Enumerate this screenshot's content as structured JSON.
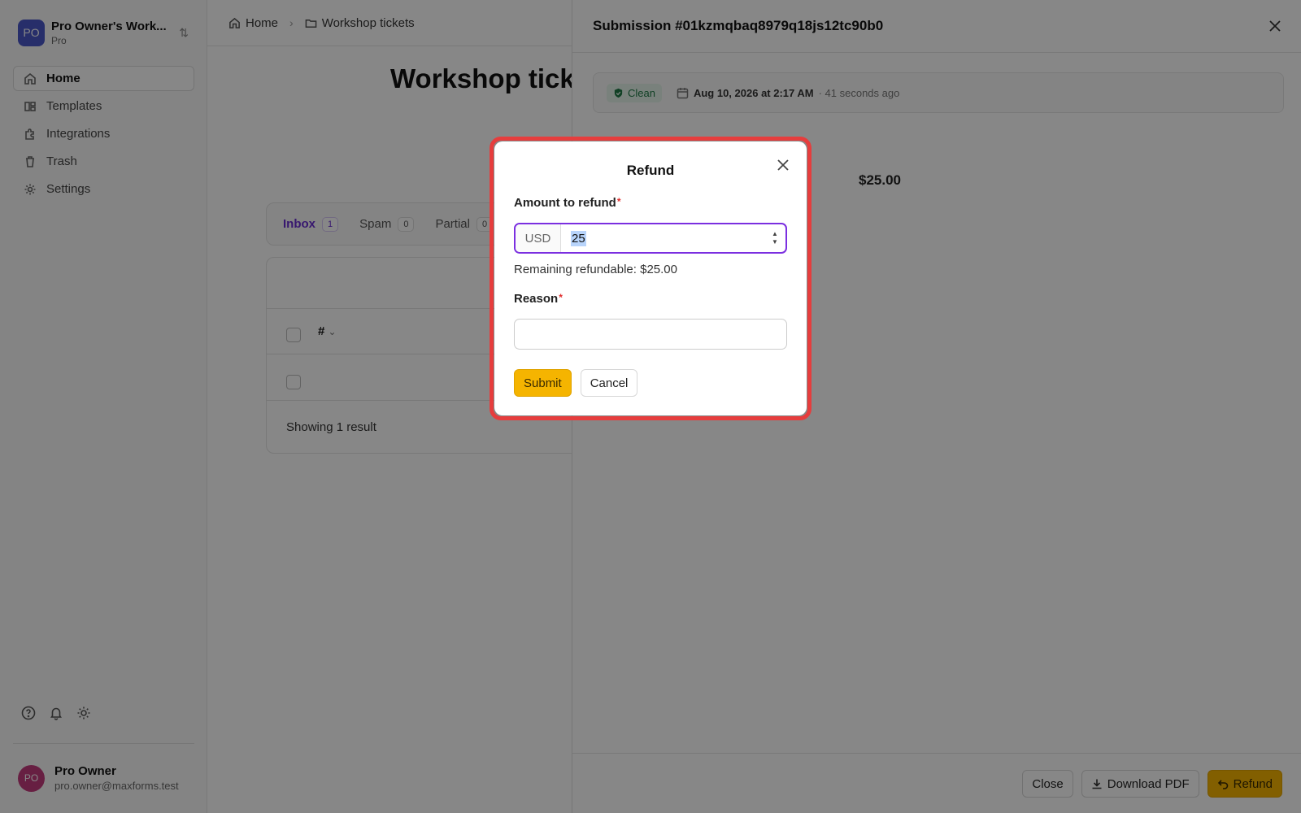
{
  "workspace": {
    "initials": "PO",
    "name": "Pro Owner's Work...",
    "plan": "Pro"
  },
  "nav": [
    {
      "label": "Home",
      "icon": "home-icon",
      "active": true
    },
    {
      "label": "Templates",
      "icon": "templates-icon"
    },
    {
      "label": "Integrations",
      "icon": "puzzle-icon"
    },
    {
      "label": "Trash",
      "icon": "trash-icon"
    },
    {
      "label": "Settings",
      "icon": "gear-icon"
    }
  ],
  "user": {
    "initials": "PO",
    "name": "Pro Owner",
    "email": "pro.owner@maxforms.test"
  },
  "breadcrumb": {
    "home": "Home",
    "current": "Workshop tickets"
  },
  "page": {
    "title": "Workshop tickets"
  },
  "tabs": [
    {
      "label": "Inbox",
      "count": "1"
    },
    {
      "label": "Spam",
      "count": "0"
    },
    {
      "label": "Partial",
      "count": "0"
    }
  ],
  "table": {
    "sort_column": "#",
    "footer": "Showing 1 result"
  },
  "panel": {
    "title": "Submission #01kzmqbaq8979q18js12tc90b0",
    "status": "Clean",
    "date": "Aug 10, 2026 at 2:17 AM",
    "ago": "· 41 seconds ago",
    "amount": "$25.00",
    "close_label": "Close",
    "download_label": "Download PDF",
    "refund_label": "Refund"
  },
  "modal": {
    "title": "Refund",
    "amount_label": "Amount to refund",
    "currency": "USD",
    "amount_value": "25",
    "remaining": "Remaining refundable: $25.00",
    "reason_label": "Reason",
    "reason_value": "",
    "submit_label": "Submit",
    "cancel_label": "Cancel"
  },
  "colors": {
    "accent": "#7b2fe0",
    "primary_button": "#f5b400",
    "highlight_ring": "#e63d3d",
    "status_clean": "#207a46"
  }
}
